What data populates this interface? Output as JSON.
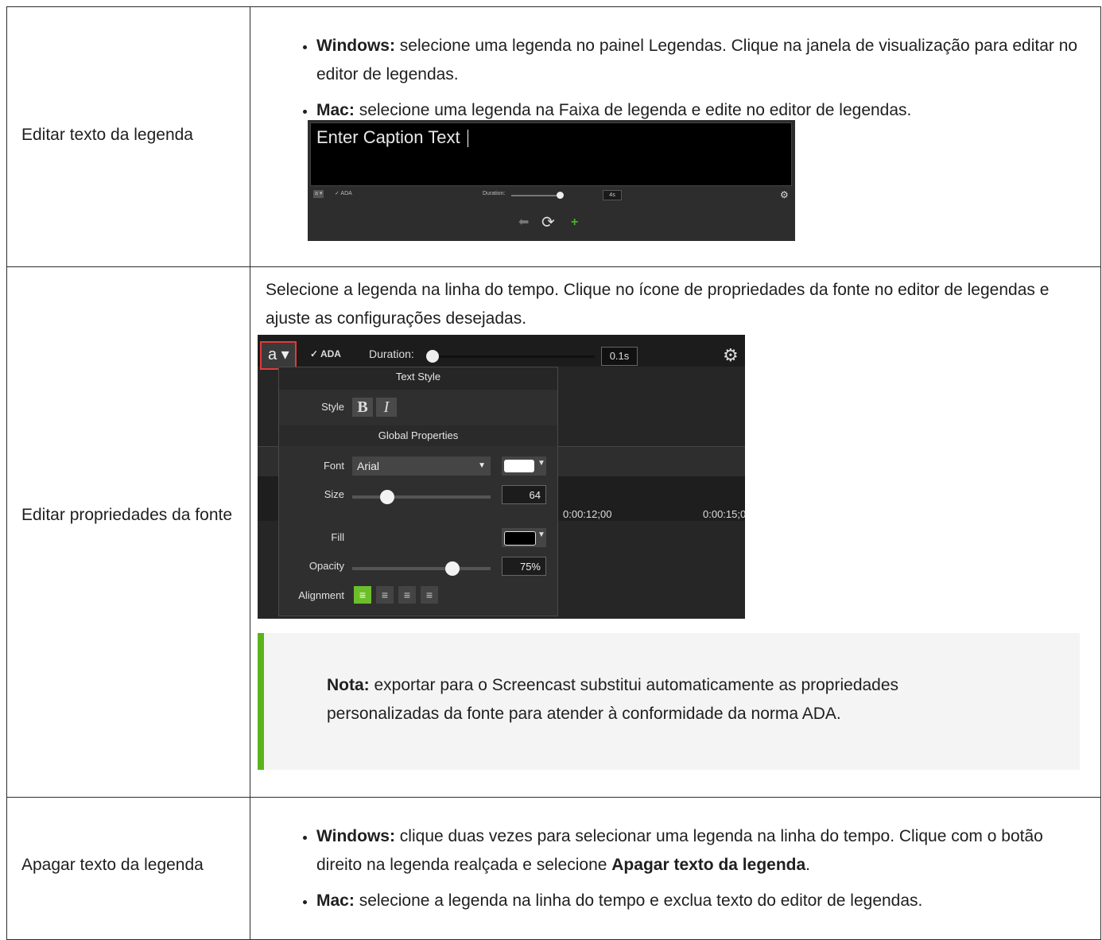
{
  "rows": [
    {
      "label": "Editar texto da legenda",
      "items": [
        {
          "bold": "Windows:",
          "text": " selecione uma legenda no painel Legendas. Clique na janela de visualização para editar no editor de legendas."
        },
        {
          "bold": "Mac:",
          "text": " selecione uma legenda na Faixa de legenda e edite no editor de legendas."
        }
      ],
      "screenshot": {
        "caption_text": "Enter Caption Text",
        "font_button": "a ▾",
        "ada_label": "✓ ADA",
        "duration_label": "Duration:",
        "duration_value": "4s",
        "gear_icon": "⚙",
        "back_icon": "⬅",
        "play_icon": "⟳",
        "add_icon": "+"
      }
    },
    {
      "label": "Editar propriedades da fonte",
      "intro": "Selecione a legenda na linha do tempo. Clique no ícone de propriedades da fonte no editor de legendas e ajuste as configurações desejadas.",
      "screenshot": {
        "font_button": "a ▾",
        "ada_label": "✓ ADA",
        "duration_label": "Duration:",
        "duration_value": "0.1s",
        "gear_icon": "⚙",
        "text_style_header": "Text Style",
        "style_label": "Style",
        "bold_button": "B",
        "italic_button": "I",
        "global_header": "Global Properties",
        "font_label": "Font",
        "font_value": "Arial",
        "font_color": "#ffffff",
        "size_label": "Size",
        "size_value": "64",
        "fill_label": "Fill",
        "fill_color": "#000000",
        "opacity_label": "Opacity",
        "opacity_value": "75%",
        "alignment_label": "Alignment",
        "timecode_1": "0:00:12;00",
        "timecode_2": "0:00:15;0",
        "accent_color": "#6cbf2a"
      },
      "note": {
        "bold": "Nota:",
        "text": " exportar para o Screencast substitui automaticamente as propriedades personalizadas da fonte para atender à conformidade da norma ADA."
      }
    },
    {
      "label": "Apagar texto da legenda",
      "items": [
        {
          "bold": "Windows:",
          "text": " clique duas vezes para selecionar uma legenda na linha do tempo. Clique com o botão direito na legenda realçada e selecione ",
          "bold2": "Apagar texto da legenda",
          "tail": "."
        },
        {
          "bold": "Mac:",
          "text": " selecione a legenda na linha do tempo e exclua texto do editor de legendas."
        }
      ]
    }
  ],
  "colors": {
    "border": "#2b2b2b",
    "note_accent": "#5cb21e",
    "note_bg": "#f4f4f4"
  }
}
